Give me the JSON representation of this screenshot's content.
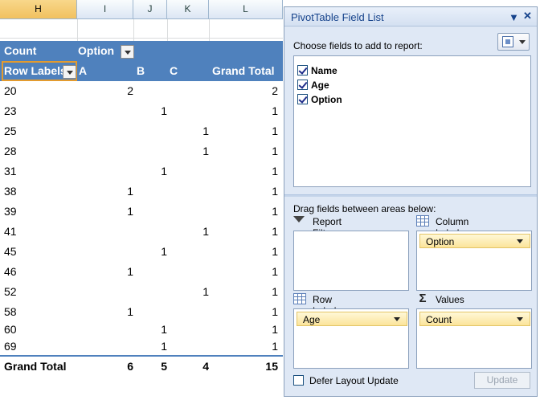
{
  "sheet": {
    "columns": [
      "H",
      "I",
      "J",
      "K",
      "L"
    ],
    "pivot": {
      "count_label": "Count",
      "option_label": "Option",
      "row_labels": "Row Labels",
      "col_headers": [
        "A",
        "B",
        "C",
        "Grand Total"
      ],
      "rows": [
        {
          "label": "20",
          "a": "2",
          "b": "",
          "c": "",
          "t": "2"
        },
        {
          "label": "23",
          "a": "",
          "b": "1",
          "c": "",
          "t": "1"
        },
        {
          "label": "25",
          "a": "",
          "b": "",
          "c": "1",
          "t": "1"
        },
        {
          "label": "28",
          "a": "",
          "b": "",
          "c": "1",
          "t": "1"
        },
        {
          "label": "31",
          "a": "",
          "b": "1",
          "c": "",
          "t": "1"
        },
        {
          "label": "38",
          "a": "1",
          "b": "",
          "c": "",
          "t": "1"
        },
        {
          "label": "39",
          "a": "1",
          "b": "",
          "c": "",
          "t": "1"
        },
        {
          "label": "41",
          "a": "",
          "b": "",
          "c": "1",
          "t": "1"
        },
        {
          "label": "45",
          "a": "",
          "b": "1",
          "c": "",
          "t": "1"
        },
        {
          "label": "46",
          "a": "1",
          "b": "",
          "c": "",
          "t": "1"
        },
        {
          "label": "52",
          "a": "",
          "b": "",
          "c": "1",
          "t": "1"
        },
        {
          "label": "58",
          "a": "1",
          "b": "",
          "c": "",
          "t": "1"
        },
        {
          "label": "60",
          "a": "",
          "b": "1",
          "c": "",
          "t": "1"
        },
        {
          "label": "69",
          "a": "",
          "b": "1",
          "c": "",
          "t": "1"
        }
      ],
      "grand_total": {
        "label": "Grand Total",
        "a": "6",
        "b": "5",
        "c": "4",
        "t": "15"
      }
    }
  },
  "pane": {
    "title": "PivotTable Field List",
    "choose_text": "Choose fields to add to report:",
    "fields": [
      {
        "label": "Name",
        "checked": true
      },
      {
        "label": "Age",
        "checked": true
      },
      {
        "label": "Option",
        "checked": true
      }
    ],
    "drag_text": "Drag fields between areas below:",
    "areas": {
      "report_filter": "Report Filter",
      "column_labels": "Column Labels",
      "row_labels": "Row Labels",
      "values": "Values"
    },
    "chips": {
      "column": "Option",
      "row": "Age",
      "values": "Count"
    },
    "defer_label": "Defer Layout Update",
    "update_label": "Update",
    "accent_colors": {
      "pivot_header": "#4f81bd",
      "selected_cell": "#e39b2f",
      "chip": "#fbe49a"
    }
  }
}
